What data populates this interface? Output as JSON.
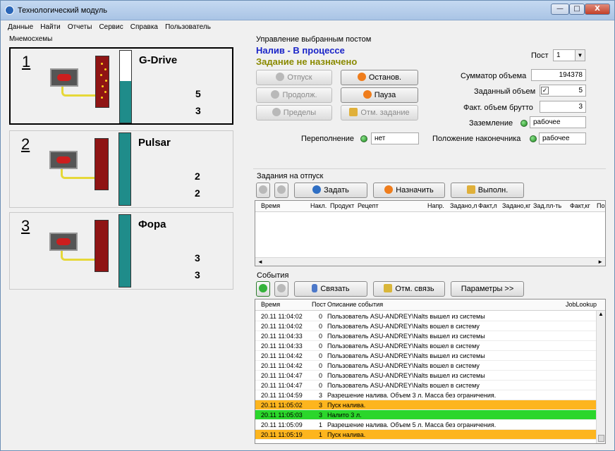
{
  "window": {
    "title": "Технологический модуль",
    "min": "—",
    "max": "□",
    "close": "X"
  },
  "menu": [
    "Данные",
    "Найти",
    "Отчеты",
    "Сервис",
    "Справка",
    "Пользователь"
  ],
  "mnemo": {
    "label": "Мнемосхемы",
    "posts": [
      {
        "num": "1",
        "name": "G-Drive",
        "v1": "5",
        "v2": "3",
        "fill": 0.58
      },
      {
        "num": "2",
        "name": "Pulsar",
        "v1": "2",
        "v2": "2",
        "fill": 1.0
      },
      {
        "num": "3",
        "name": "Фора",
        "v1": "3",
        "v2": "3",
        "fill": 1.0
      }
    ]
  },
  "control": {
    "label": "Управление выбранным постом",
    "status1": "Налив - В процессе",
    "status2": "Задание не назначено",
    "post_label": "Пост",
    "post_value": "1",
    "btn_release": "Отпуск",
    "btn_stop": "Останов.",
    "btn_continue": "Продолж.",
    "btn_pause": "Пауза",
    "btn_limits": "Пределы",
    "btn_cancel_task": "Отм. задание",
    "overflow_label": "Переполнение",
    "overflow_value": "нет",
    "summator_label": "Сумматор объема",
    "summator_value": "194378",
    "set_volume_label": "Заданный объем",
    "set_volume_check": "✓",
    "set_volume_value": "5",
    "fact_label": "Факт. объем брутто",
    "fact_value": "3",
    "ground_label": "Заземление",
    "ground_value": "рабочее",
    "nozzle_label": "Положение наконечника",
    "nozzle_value": "рабочее"
  },
  "tasks": {
    "label": "Задания на отпуск",
    "btn_set": "Задать",
    "btn_assign": "Назначить",
    "btn_exec": "Выполн.",
    "columns": [
      "Время",
      "Накл.",
      "Продукт",
      "Рецепт",
      "Напр.",
      "Задано,л",
      "Факт,л",
      "Задано,кг",
      "Зад.пл-ть",
      "Факт,кг",
      "Пор"
    ]
  },
  "events": {
    "label": "События",
    "btn_link": "Связать",
    "btn_unlink": "Отм. связь",
    "btn_params": "Параметры >>",
    "columns": [
      "Время",
      "Пост",
      "Описание события",
      "JobLookup"
    ],
    "rows": [
      {
        "time": "20.11 11:04:02",
        "post": "0",
        "desc": "Пользователь ASU-ANDREY\\Nalts вышел из системы",
        "hl": ""
      },
      {
        "time": "20.11 11:04:02",
        "post": "0",
        "desc": "Пользователь ASU-ANDREY\\Nalts вошел в систему",
        "hl": ""
      },
      {
        "time": "20.11 11:04:33",
        "post": "0",
        "desc": "Пользователь ASU-ANDREY\\Nalts вышел из системы",
        "hl": ""
      },
      {
        "time": "20.11 11:04:33",
        "post": "0",
        "desc": "Пользователь ASU-ANDREY\\Nalts вошел в систему",
        "hl": ""
      },
      {
        "time": "20.11 11:04:42",
        "post": "0",
        "desc": "Пользователь ASU-ANDREY\\Nalts вышел из системы",
        "hl": ""
      },
      {
        "time": "20.11 11:04:42",
        "post": "0",
        "desc": "Пользователь ASU-ANDREY\\Nalts вошел в систему",
        "hl": ""
      },
      {
        "time": "20.11 11:04:47",
        "post": "0",
        "desc": "Пользователь ASU-ANDREY\\Nalts вышел из системы",
        "hl": ""
      },
      {
        "time": "20.11 11:04:47",
        "post": "0",
        "desc": "Пользователь ASU-ANDREY\\Nalts вошел в систему",
        "hl": ""
      },
      {
        "time": "20.11 11:04:59",
        "post": "3",
        "desc": "Разрешение налива. Объем 3 л. Масса без ограничения.",
        "hl": ""
      },
      {
        "time": "20.11 11:05:02",
        "post": "3",
        "desc": "Пуск налива.",
        "hl": "orange"
      },
      {
        "time": "20.11 11:05:03",
        "post": "3",
        "desc": "Налито 3 л.",
        "hl": "green"
      },
      {
        "time": "20.11 11:05:09",
        "post": "1",
        "desc": "Разрешение налива. Объем 5 л. Масса без ограничения.",
        "hl": ""
      },
      {
        "time": "20.11 11:05:19",
        "post": "1",
        "desc": "Пуск налива.",
        "hl": "orange"
      }
    ]
  },
  "colors": {
    "status1": "#1a24c8",
    "status2": "#8a8a00",
    "row_orange": "#fdb51e",
    "row_green": "#2bd62b"
  }
}
